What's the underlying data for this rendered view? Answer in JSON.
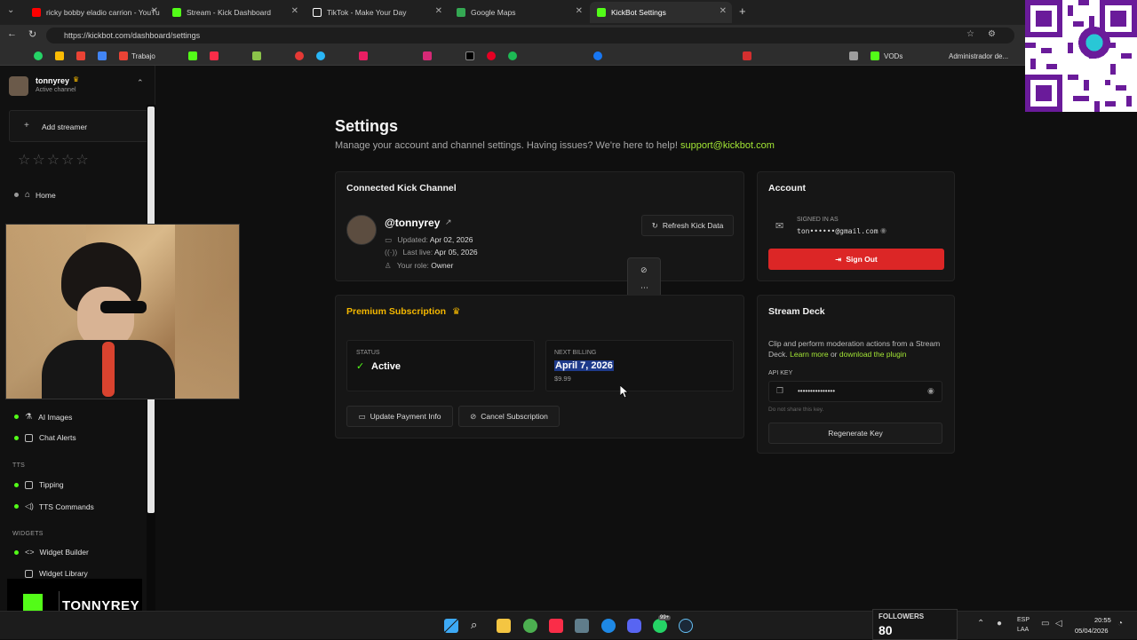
{
  "browser": {
    "tabs": [
      {
        "label": "ricky bobby eladio carrion - YouTu",
        "color": "#ff0000"
      },
      {
        "label": "Stream - Kick Dashboard",
        "color": "#53fc18"
      },
      {
        "label": "TikTok - Make Your Day",
        "color": "#ffffff"
      },
      {
        "label": "Google Maps",
        "color": "#34a853"
      },
      {
        "label": "KickBot Settings",
        "color": "#53fc18"
      }
    ],
    "url": "https://kickbot.com/dashboard/settings",
    "bookmarks": {
      "trabajo": "Trabajo",
      "vods": "VODs",
      "admin": "Administrador de..."
    }
  },
  "sidebar": {
    "user_name": "tonnyrey",
    "user_status": "Active channel",
    "add_streamer": "Add streamer",
    "home": "Home",
    "ai_images": "AI Images",
    "chat_alerts": "Chat Alerts",
    "tts_header": "TTS",
    "tipping": "Tipping",
    "tts_commands": "TTS Commands",
    "widgets_header": "WIDGETS",
    "widget_builder": "Widget Builder",
    "widget_library": "Widget Library"
  },
  "page": {
    "title": "Settings",
    "subtitle": "Manage your account and channel settings. Having issues? We're here to help!",
    "support_email": "support@kickbot.com"
  },
  "kick_channel": {
    "heading": "Connected Kick Channel",
    "handle": "@tonnyrey",
    "updated_label": "Updated:",
    "updated": "Apr 02, 2026",
    "last_live_label": "Last live:",
    "last_live": "Apr 05, 2026",
    "role_label": "Your role:",
    "role": "Owner",
    "refresh": "Refresh Kick Data"
  },
  "subscription": {
    "heading": "Premium Subscription",
    "status_label": "STATUS",
    "status": "Active",
    "next_billing_label": "NEXT BILLING",
    "next_billing_date": "April 7, 2026",
    "price": "$9.99",
    "update_payment": "Update Payment Info",
    "cancel": "Cancel Subscription"
  },
  "account": {
    "heading": "Account",
    "signed_in_label": "SIGNED IN AS",
    "email": "ton••••••@gmail.com",
    "sign_out": "Sign Out"
  },
  "stream_deck": {
    "heading": "Stream Deck",
    "description": "Clip and perform moderation actions from a Stream Deck.",
    "learn_more": "Learn more",
    "or": "or",
    "download": "download the plugin",
    "api_key_label": "API KEY",
    "api_key_value": "•••••••••••••••",
    "hint": "Do not share this key.",
    "regenerate": "Regenerate Key"
  },
  "overlay": {
    "brand": "TONNYREY",
    "followers_label": "FOLLOWERS",
    "followers": "80",
    "lang": "ESP",
    "lang2": "LAA",
    "time": "20:55",
    "date": "05/04/2026",
    "badge": "99+"
  },
  "colors": {
    "accent": "#53fc18",
    "danger": "#dc2626",
    "gold": "#f5b800",
    "link": "#a3e635"
  }
}
